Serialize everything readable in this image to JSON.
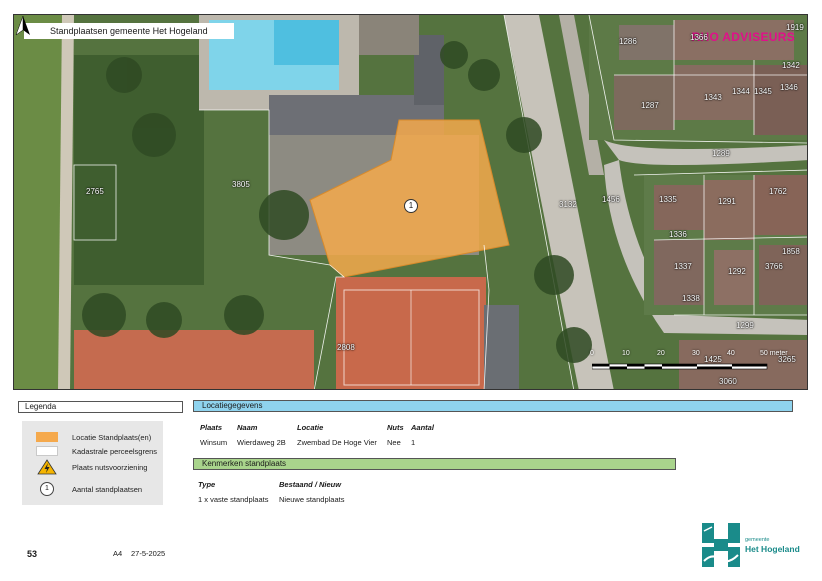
{
  "map": {
    "title": "Standplaatsen gemeente Het Hogeland",
    "brand": "RHO ADVISEURS",
    "marker_label": "1",
    "parcel_labels": [
      "2765",
      "3805",
      "3132",
      "1456",
      "2808",
      "1335",
      "1336",
      "1337",
      "1338",
      "1291",
      "1292",
      "1289",
      "1287",
      "1286",
      "1343",
      "1344",
      "1345",
      "1346",
      "1342",
      "1366",
      "1919",
      "3766",
      "1858",
      "1299",
      "1425",
      "3060",
      "1762",
      "3265"
    ],
    "scale_ticks": [
      "0",
      "10",
      "20",
      "30",
      "40",
      "50 meter"
    ],
    "north_symbol": "N"
  },
  "legend": {
    "header": "Legenda",
    "items": [
      {
        "label": "Locatie Standplaats(en)",
        "symbol": "orange-fill",
        "color": "#f5a94c"
      },
      {
        "label": "Kadastrale perceelsgrens",
        "symbol": "white-outline",
        "color": "#ffffff"
      },
      {
        "label": "Plaats nutsvoorziening",
        "symbol": "warning-icon",
        "color": "#f5b400"
      },
      {
        "label": "Aantal standplaatsen",
        "symbol": "number-circle",
        "value": "1"
      }
    ]
  },
  "location": {
    "header": "Locatiegegevens",
    "columns": [
      "Plaats",
      "Naam",
      "Locatie",
      "Nuts",
      "Aantal"
    ],
    "row": [
      "Winsum",
      "Wierdaweg 2B",
      "Zwembad De Hoge Vier",
      "Nee",
      "1"
    ]
  },
  "characteristics": {
    "header": "Kenmerken standplaats",
    "columns": [
      "Type",
      "Bestaand / Nieuw"
    ],
    "row": [
      "1 x vaste standplaats",
      "Nieuwe standplaats"
    ]
  },
  "footer": {
    "page_number": "53",
    "paper_size": "A4",
    "date": "27-5-2025",
    "logo_small": "gemeente",
    "logo_big": "Het Hogeland"
  },
  "colors": {
    "location_fill": "#f5a94c",
    "header_blue": "#8fd3ee",
    "header_green": "#a9d48c",
    "logo_teal": "#1a8b8a"
  }
}
